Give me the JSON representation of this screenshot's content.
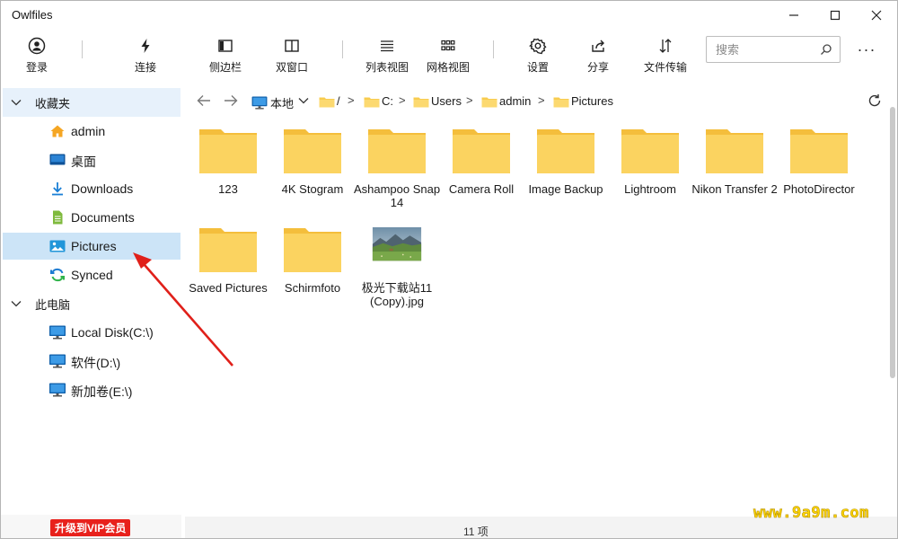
{
  "window": {
    "title": "Owlfiles"
  },
  "toolbar": {
    "buttons": [
      {
        "label": "登录",
        "icon": "user-icon"
      },
      {
        "label": "连接",
        "icon": "lightning-icon"
      },
      {
        "label": "侧边栏",
        "icon": "sidebar-icon"
      },
      {
        "label": "双窗口",
        "icon": "dual-pane-icon"
      },
      {
        "label": "列表视图",
        "icon": "list-view-icon"
      },
      {
        "label": "网格视图",
        "icon": "grid-view-icon"
      },
      {
        "label": "设置",
        "icon": "gear-icon"
      },
      {
        "label": "分享",
        "icon": "share-icon"
      },
      {
        "label": "文件传输",
        "icon": "transfer-icon"
      }
    ],
    "search_placeholder": "搜索",
    "more_label": "···"
  },
  "sidebar": {
    "favorites": {
      "label": "收藏夹",
      "items": [
        {
          "label": "admin",
          "icon": "home-icon"
        },
        {
          "label": "桌面",
          "icon": "desktop-icon"
        },
        {
          "label": "Downloads",
          "icon": "download-icon"
        },
        {
          "label": "Documents",
          "icon": "document-icon"
        },
        {
          "label": "Pictures",
          "icon": "picture-icon",
          "selected": true
        },
        {
          "label": "Synced",
          "icon": "sync-icon"
        }
      ]
    },
    "this_pc": {
      "label": "此电脑",
      "items": [
        {
          "label": "Local Disk(C:\\)",
          "icon": "monitor-icon"
        },
        {
          "label": "软件(D:\\)",
          "icon": "monitor-icon"
        },
        {
          "label": "新加卷(E:\\)",
          "icon": "monitor-icon"
        }
      ]
    }
  },
  "address": {
    "root_label": "本地",
    "crumbs": [
      "/",
      "C:",
      "Users",
      "admin",
      "Pictures"
    ]
  },
  "files": [
    {
      "name": "123",
      "type": "folder"
    },
    {
      "name": "4K Stogram",
      "type": "folder"
    },
    {
      "name": "Ashampoo Snap 14",
      "type": "folder"
    },
    {
      "name": "Camera Roll",
      "type": "folder"
    },
    {
      "name": "Image Backup",
      "type": "folder"
    },
    {
      "name": "Lightroom",
      "type": "folder"
    },
    {
      "name": "Nikon Transfer 2",
      "type": "folder"
    },
    {
      "name": "PhotoDirector",
      "type": "folder"
    },
    {
      "name": "Saved Pictures",
      "type": "folder"
    },
    {
      "name": "Schirmfoto",
      "type": "folder"
    },
    {
      "name": "极光下载站11 (Copy).jpg",
      "type": "image"
    }
  ],
  "status": {
    "count": "11 项",
    "vip_label": "升级到VIP会员"
  },
  "watermark": "www.9a9m.com",
  "colors": {
    "folder": "#fbd360",
    "folder_tab": "#f4be3c",
    "selected": "#cce4f7",
    "accent_blue": "#0b73d1",
    "vip": "#e8211c",
    "annotation_arrow": "#e0201a"
  }
}
